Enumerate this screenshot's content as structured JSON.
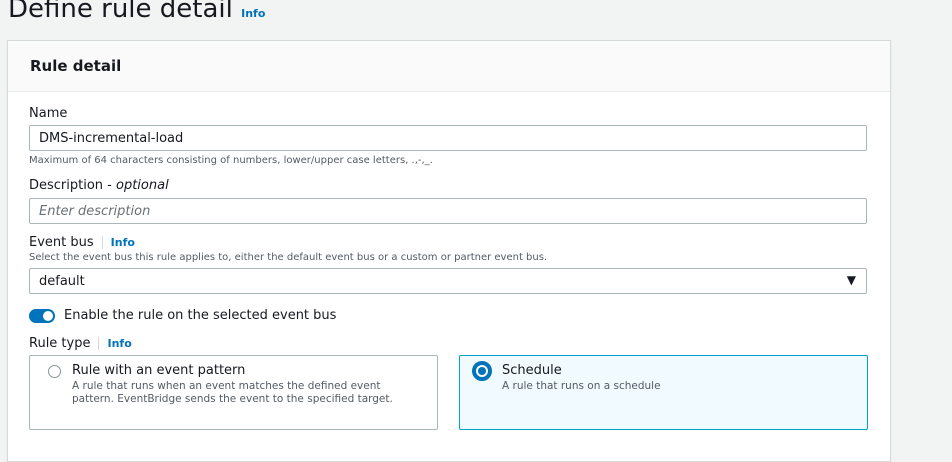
{
  "page": {
    "title": "Define rule detail",
    "info": "Info"
  },
  "panel": {
    "title": "Rule detail"
  },
  "name": {
    "label": "Name",
    "value": "DMS-incremental-load",
    "hint": "Maximum of 64 characters consisting of numbers, lower/upper case letters, .,-,_."
  },
  "description": {
    "label": "Description - ",
    "optional": "optional",
    "placeholder": "Enter description"
  },
  "event_bus": {
    "label": "Event bus",
    "info": "Info",
    "hint": "Select the event bus this rule applies to, either the default event bus or a custom or partner event bus.",
    "value": "default"
  },
  "toggle": {
    "label": "Enable the rule on the selected event bus",
    "enabled": true
  },
  "rule_type": {
    "label": "Rule type",
    "info": "Info",
    "options": [
      {
        "title": "Rule with an event pattern",
        "desc": "A rule that runs when an event matches the defined event pattern. EventBridge sends the event to the specified target.",
        "selected": false
      },
      {
        "title": "Schedule",
        "desc": "A rule that runs on a schedule",
        "selected": true
      }
    ]
  }
}
